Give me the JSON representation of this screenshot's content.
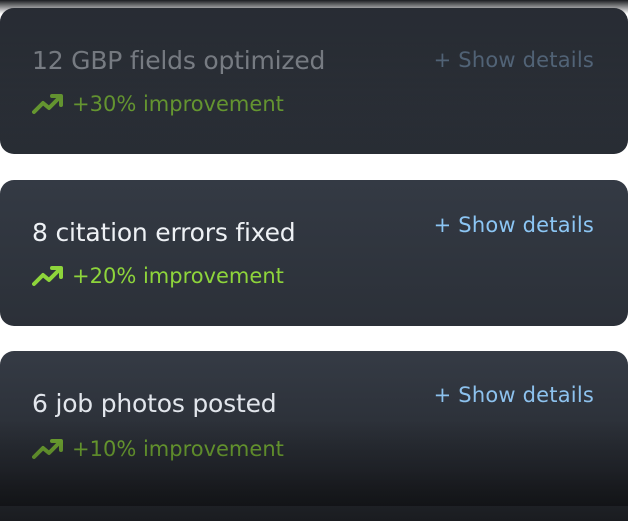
{
  "cards": [
    {
      "title": "12 GBP fields optimized",
      "improvement": "+30% improvement",
      "details_label": "+ Show details"
    },
    {
      "title": "8 citation errors fixed",
      "improvement": "+20% improvement",
      "details_label": "+ Show details"
    },
    {
      "title": "6 job photos posted",
      "improvement": "+10% improvement",
      "details_label": "+ Show details"
    }
  ],
  "icons": {
    "metric": "trending-up-icon"
  },
  "colors": {
    "card_bg": "#2f343c",
    "title": "#eef1f5",
    "improvement": "#8ed53b",
    "link": "#8cc6f4"
  }
}
